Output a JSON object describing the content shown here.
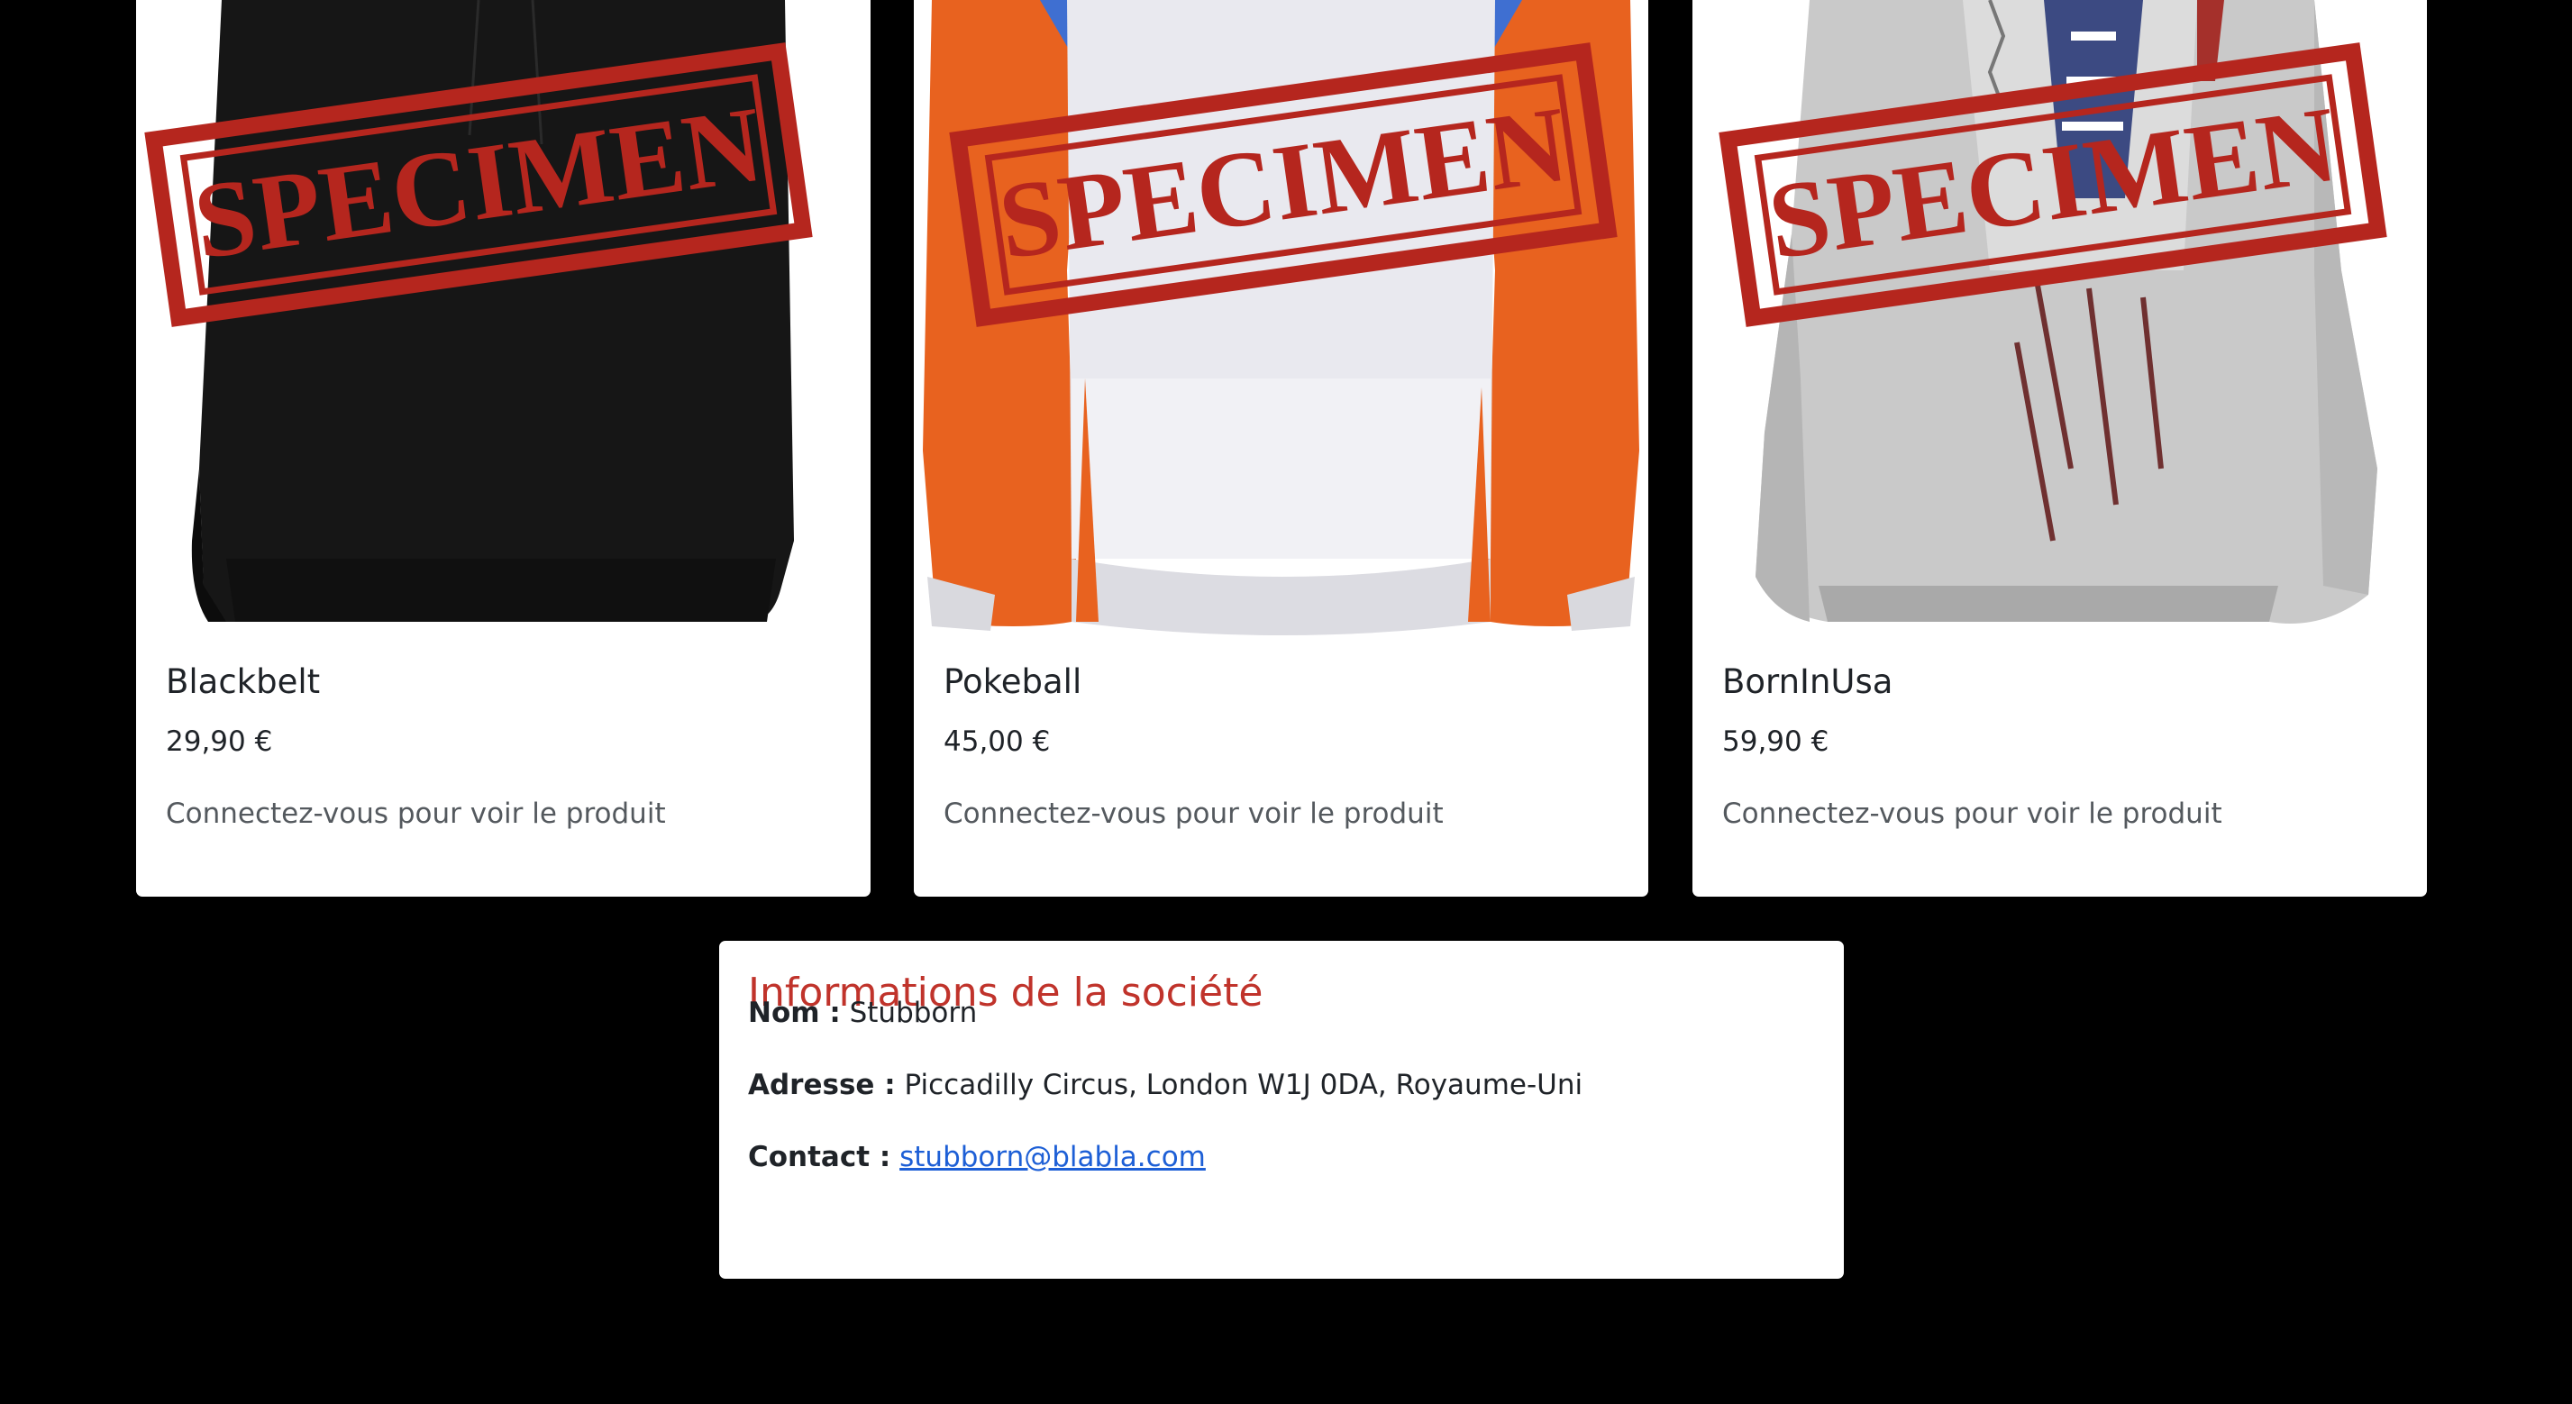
{
  "products": [
    {
      "name": "Blackbelt",
      "price": "29,90 €",
      "login_hint": "Connectez-vous pour voir le produit",
      "stamp": "SPECIMEN"
    },
    {
      "name": "Pokeball",
      "price": "45,00 €",
      "login_hint": "Connectez-vous pour voir le produit",
      "stamp": "SPECIMEN"
    },
    {
      "name": "BornInUsa",
      "price": "59,90 €",
      "login_hint": "Connectez-vous pour voir le produit",
      "stamp": "SPECIMEN"
    }
  ],
  "company": {
    "title": "Informations de la société",
    "name_label": "Nom :",
    "name_value": "Stubborn",
    "address_label": "Adresse :",
    "address_value": "Piccadilly Circus, London W1J 0DA, Royaume-Uni",
    "contact_label": "Contact :",
    "contact_value": "stubborn@blabla.com"
  },
  "colors": {
    "page_background": "#000000",
    "card_background": "#ffffff",
    "stamp_red": "#b5261e",
    "company_title": "#c0332b",
    "link": "#1d5fd6"
  },
  "icons": [
    "hoodie-black-image",
    "hoodie-orange-white-image",
    "hoodie-grey-flag-image",
    "specimen-stamp"
  ]
}
